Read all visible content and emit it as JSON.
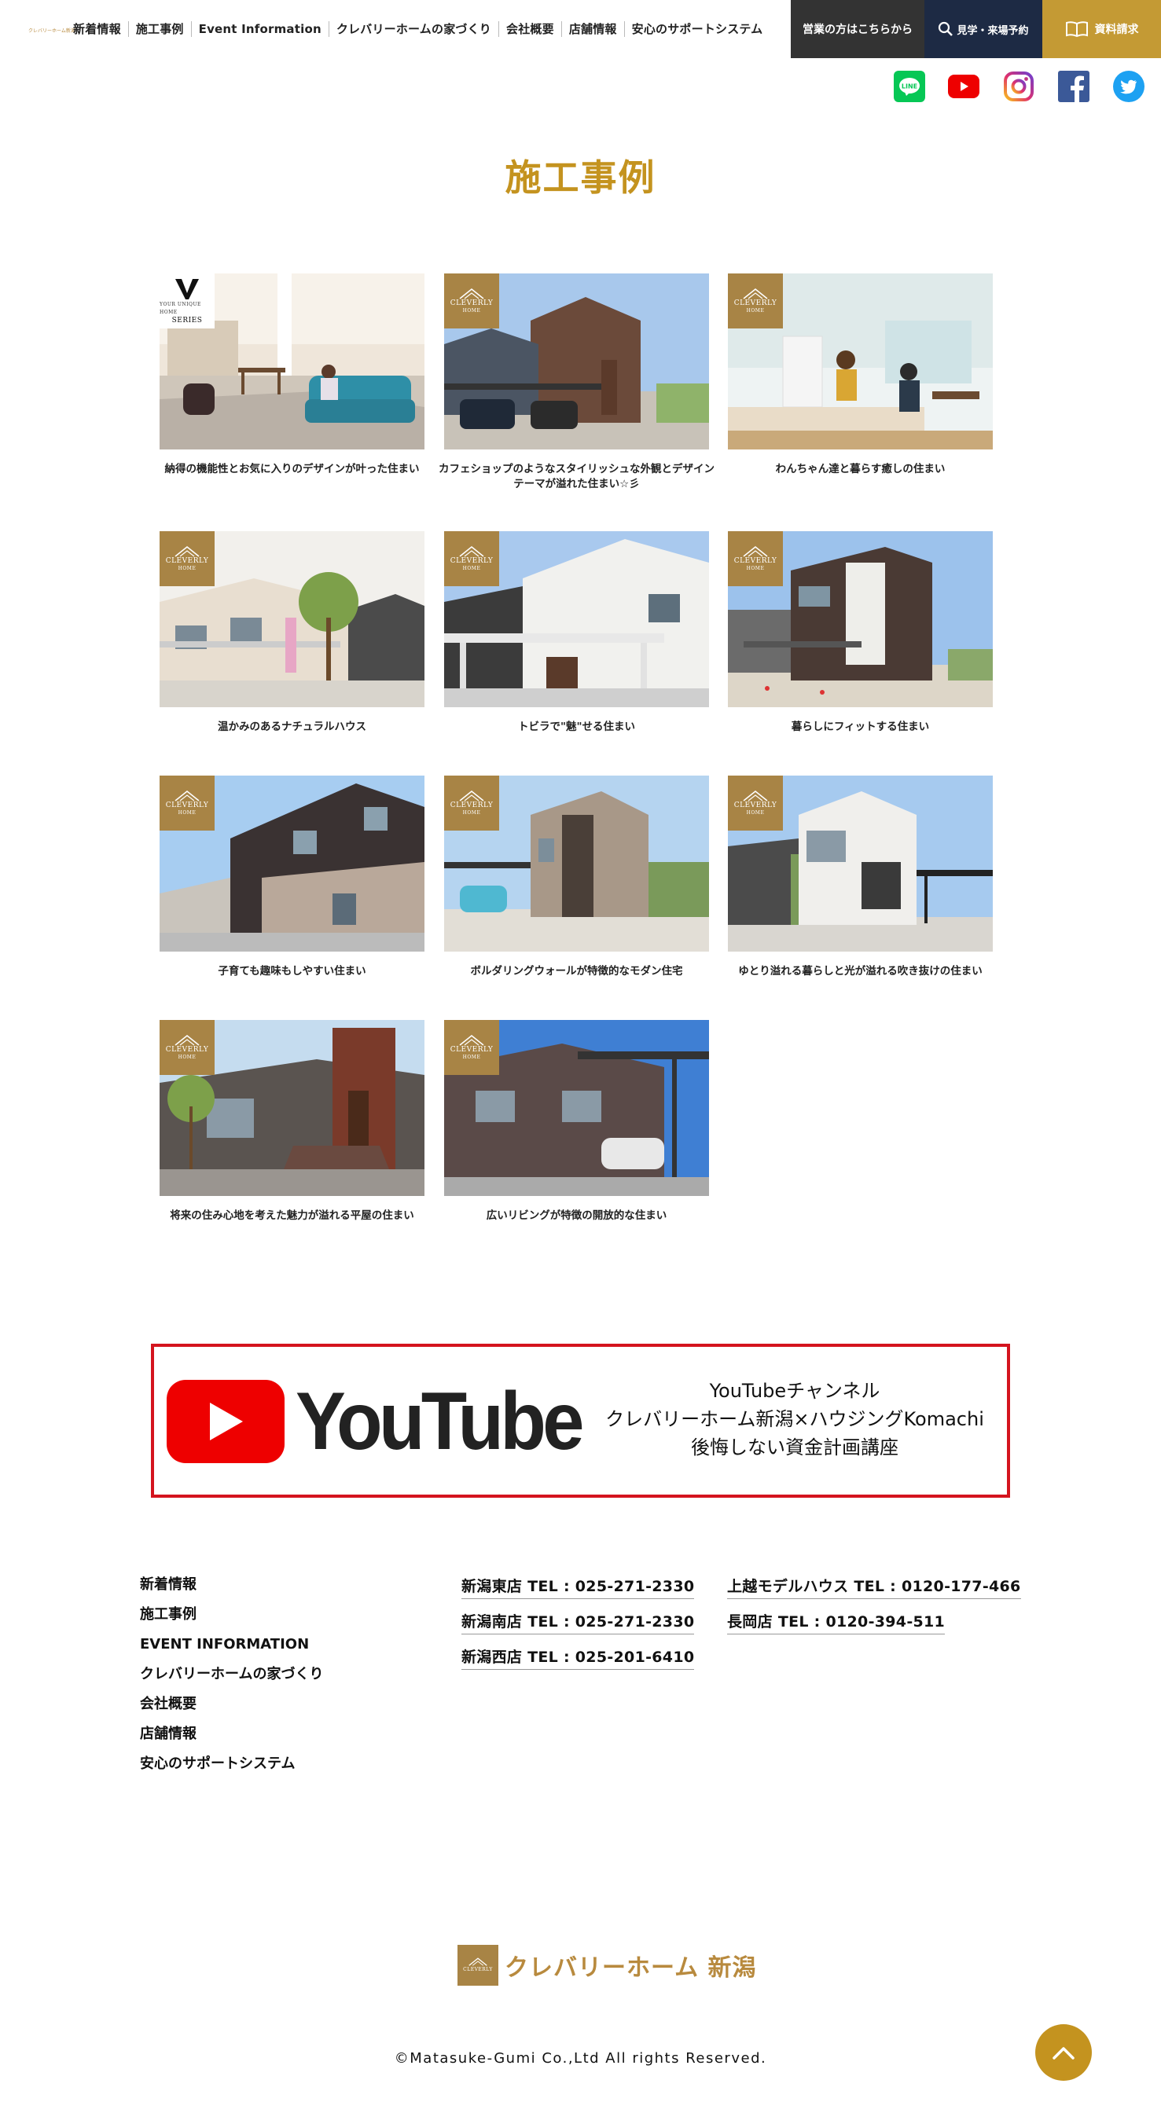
{
  "header": {
    "logo_text": "クレバリーホーム新潟",
    "nav": [
      "新着情報",
      "施工事例",
      "Event Information",
      "クレバリーホームの家づくり",
      "会社概要",
      "店舗情報",
      "安心のサポートシステム"
    ],
    "sales_label": "営業の方はこちらから",
    "visit_label": "見学・来場予約",
    "docs_label": "資料請求"
  },
  "social": [
    "LINE",
    "YouTube",
    "Instagram",
    "Facebook",
    "Twitter"
  ],
  "page_title": "施工事例",
  "badges": {
    "cleverly_line1": "CLEVERLY",
    "cleverly_line2": "HOME",
    "v_series_small": "YOUR UNIQUE HOME",
    "v_series_label": "SERIES"
  },
  "cases": [
    {
      "caption": "納得の機能性とお気に入りのデザインが叶った住まい",
      "badge": "v-series"
    },
    {
      "caption": "カフェショップのようなスタイリッシュな外観とデザインテーマが溢れた住まい☆彡",
      "badge": "cleverly"
    },
    {
      "caption": "わんちゃん達と暮らす癒しの住まい",
      "badge": "cleverly"
    },
    {
      "caption": "温かみのあるナチュラルハウス",
      "badge": "cleverly"
    },
    {
      "caption": "トビラで\"魅\"せる住まい",
      "badge": "cleverly"
    },
    {
      "caption": "暮らしにフィットする住まい",
      "badge": "cleverly"
    },
    {
      "caption": "子育ても趣味もしやすい住まい",
      "badge": "cleverly"
    },
    {
      "caption": "ボルダリングウォールが特徴的なモダン住宅",
      "badge": "cleverly"
    },
    {
      "caption": "ゆとり溢れる暮らしと光が溢れる吹き抜けの住まい",
      "badge": "cleverly"
    },
    {
      "caption": "将来の住み心地を考えた魅力が溢れる平屋の住まい",
      "badge": "cleverly"
    },
    {
      "caption": "広いリビングが特徴の開放的な住まい",
      "badge": "cleverly"
    }
  ],
  "youtube_banner": {
    "wordmark": "YouTube",
    "line1": "YouTubeチャンネル",
    "line2": "クレバリーホーム新潟×ハウジングKomachi",
    "line3": "後悔しない資金計画講座"
  },
  "footer": {
    "nav": [
      "新着情報",
      "施工事例",
      "EVENT INFORMATION",
      "クレバリーホームの家づくり",
      "会社概要",
      "店舗情報",
      "安心のサポートシステム"
    ],
    "shops": [
      "新潟東店 TEL : 025-271-2330",
      "新潟南店 TEL : 025-271-2330",
      "新潟西店 TEL : 025-201-6410",
      "上越モデルハウス TEL : 0120-177-466",
      "長岡店 TEL : 0120-394-511"
    ],
    "logo_text": "クレバリーホーム 新潟",
    "copyright": "©Matasuke-Gumi Co.,Ltd All rights Reserved."
  },
  "colors": {
    "gold": "#c4931f",
    "badge_brown": "#a88445",
    "navy": "#1d2a44",
    "youtube_red": "#ee0000"
  }
}
